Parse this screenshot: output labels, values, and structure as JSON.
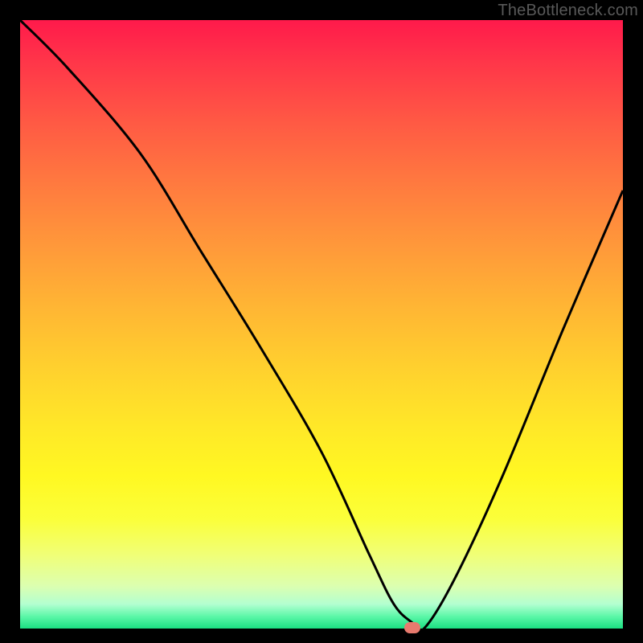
{
  "watermark": "TheBottleneck.com",
  "chart_data": {
    "type": "line",
    "title": "",
    "xlabel": "",
    "ylabel": "",
    "xlim": [
      0,
      100
    ],
    "ylim": [
      0,
      100
    ],
    "grid": false,
    "legend": false,
    "background": "red-yellow-green vertical gradient (red top, green bottom)",
    "series": [
      {
        "name": "bottleneck-curve",
        "color": "#000000",
        "x": [
          0,
          8,
          20,
          30,
          40,
          50,
          58,
          62,
          65,
          67,
          72,
          80,
          90,
          100
        ],
        "y": [
          100,
          92,
          78,
          62,
          46,
          29,
          12,
          4,
          1,
          0,
          8,
          25,
          49,
          72
        ]
      }
    ],
    "marker": {
      "name": "optimal-point",
      "x": 65,
      "y": 0,
      "color": "#e87a6e"
    }
  }
}
